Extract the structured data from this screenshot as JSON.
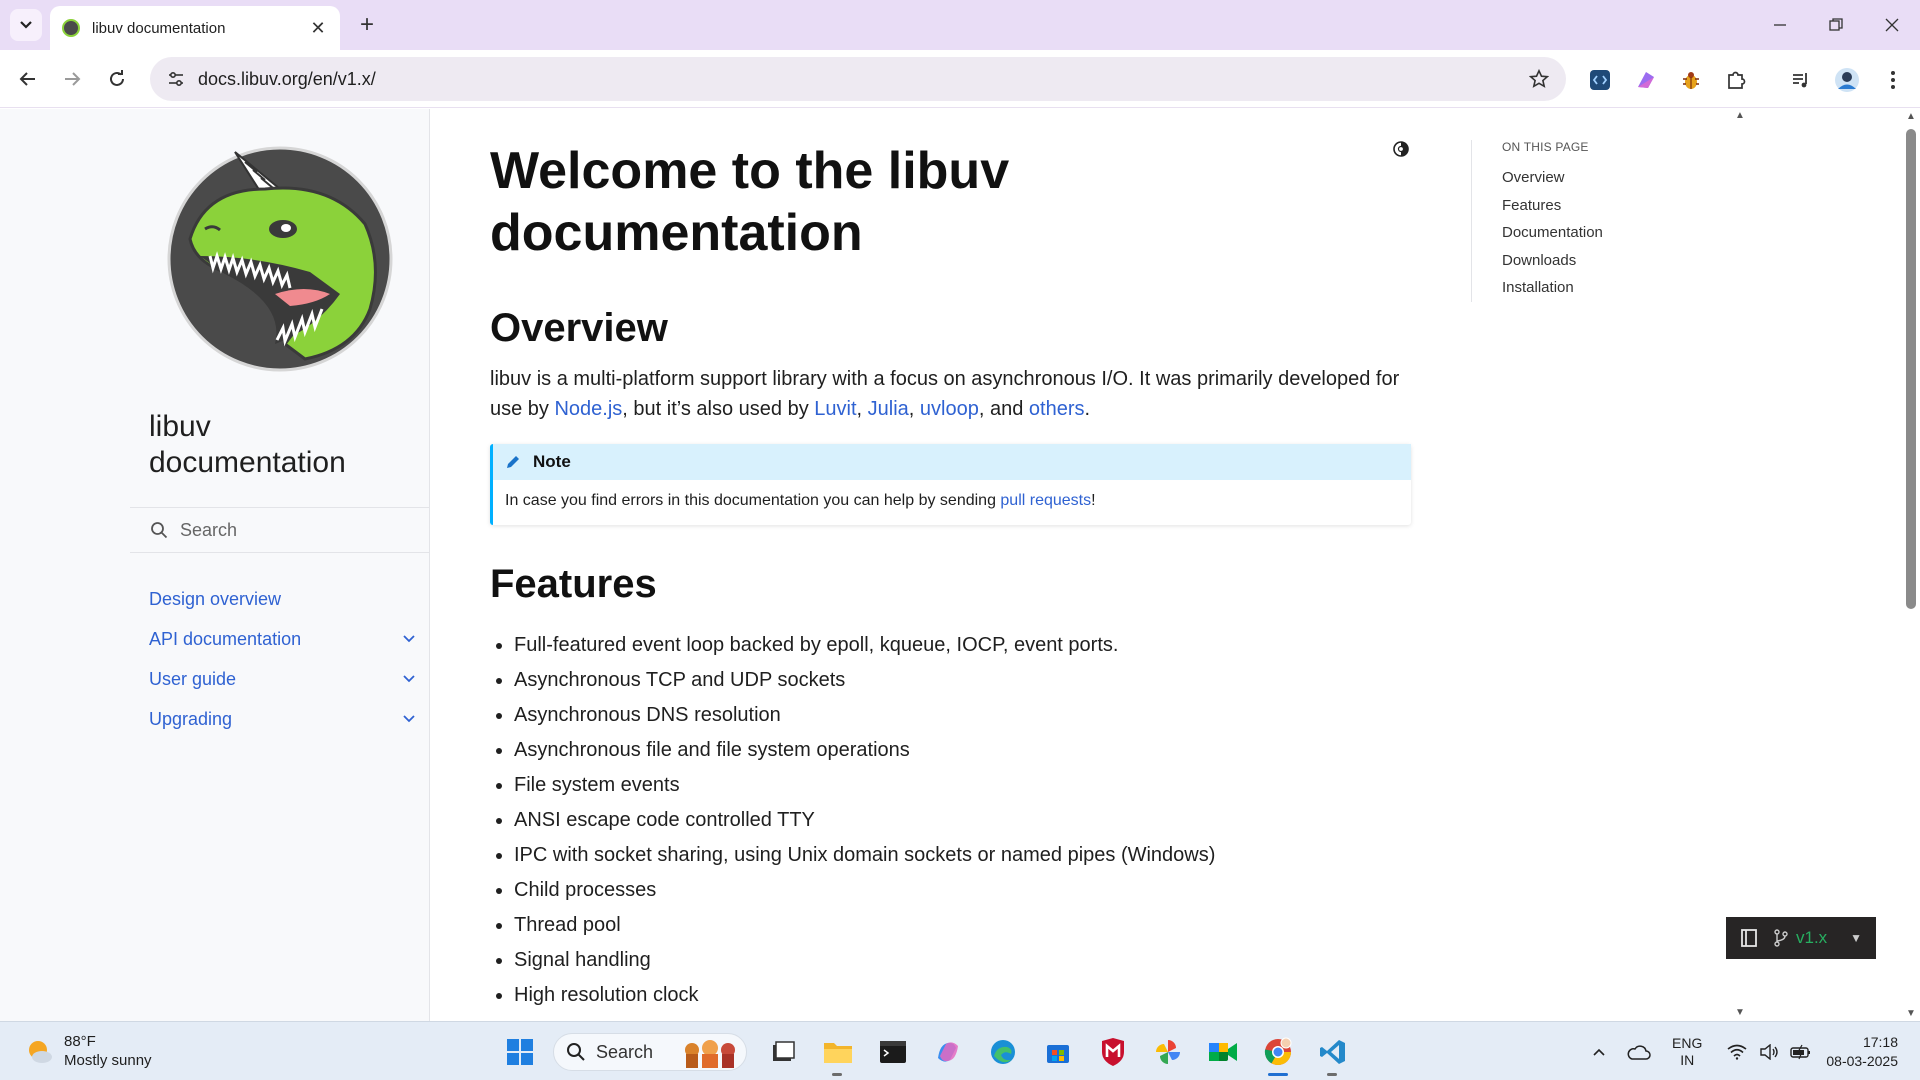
{
  "browser": {
    "tab_title": "libuv documentation",
    "url": "docs.libuv.org/en/v1.x/"
  },
  "sidebar": {
    "brand": "libuv documentation",
    "search_placeholder": "Search",
    "items": [
      {
        "label": "Design overview",
        "expandable": false
      },
      {
        "label": "API documentation",
        "expandable": true
      },
      {
        "label": "User guide",
        "expandable": true
      },
      {
        "label": "Upgrading",
        "expandable": true
      }
    ]
  },
  "main": {
    "title": "Welcome to the libuv documentation",
    "overview_heading": "Overview",
    "overview": {
      "t1": "libuv is a multi-platform support library with a focus on asynchronous I/O. It was primarily developed for use by ",
      "link_nodejs": "Node.js",
      "t2": ", but it’s also used by ",
      "link_luvit": "Luvit",
      "t3": ", ",
      "link_julia": "Julia",
      "t4": ", ",
      "link_uvloop": "uvloop",
      "t5": ", and ",
      "link_others": "others",
      "t6": "."
    },
    "note": {
      "title": "Note",
      "text": "In case you find errors in this documentation you can help by sending ",
      "link": "pull requests",
      "suffix": "!"
    },
    "features_heading": "Features",
    "features": [
      "Full-featured event loop backed by epoll, kqueue, IOCP, event ports.",
      "Asynchronous TCP and UDP sockets",
      "Asynchronous DNS resolution",
      "Asynchronous file and file system operations",
      "File system events",
      "ANSI escape code controlled TTY",
      "IPC with socket sharing, using Unix domain sockets or named pipes (Windows)",
      "Child processes",
      "Thread pool",
      "Signal handling",
      "High resolution clock"
    ]
  },
  "toc": {
    "title": "ON THIS PAGE",
    "items": [
      "Overview",
      "Features",
      "Documentation",
      "Downloads",
      "Installation"
    ]
  },
  "rtd": {
    "version": "v1.x"
  },
  "taskbar": {
    "weather_temp": "88°F",
    "weather_desc": "Mostly sunny",
    "search_label": "Search",
    "lang_line1": "ENG",
    "lang_line2": "IN",
    "time": "17:18",
    "date": "08-03-2025"
  },
  "colors": {
    "link": "#2f62d2",
    "tabstrip": "#e9ddf6",
    "note_header": "#d8f1fd",
    "note_border": "#00b0ff",
    "rtd_green": "#27ae60"
  }
}
